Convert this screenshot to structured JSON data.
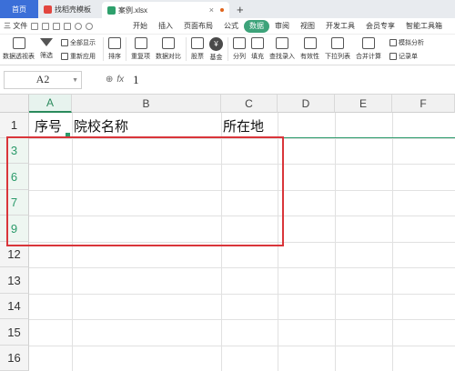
{
  "tabs": [
    {
      "label": "首页"
    },
    {
      "label": "找稻壳模板"
    },
    {
      "label": "案例.xlsx"
    }
  ],
  "tab_plus": "+",
  "menu_left": {
    "file": "三 文件"
  },
  "menus": [
    "开始",
    "插入",
    "页面布局",
    "公式",
    "数据",
    "审阅",
    "视图",
    "开发工具",
    "会员专享",
    "智能工具箱"
  ],
  "ribbon": {
    "pivot": "数据透视表",
    "filter": "筛选",
    "show_all": "全部显示",
    "reapply": "重新应用",
    "sort": "排序",
    "dup": "重复项",
    "compare": "数据对比",
    "stock": "股票",
    "fund": "基金",
    "split": "分列",
    "fill": "填充",
    "lookup": "查找录入",
    "valid": "有效性",
    "dropdown": "下拉列表",
    "merge": "合并计算",
    "sim": "模拟分析",
    "record": "记录单"
  },
  "formula": {
    "cell_ref": "A2",
    "fx": "fx",
    "value": "1"
  },
  "columns": [
    "A",
    "B",
    "C",
    "D",
    "E",
    "F"
  ],
  "rows": [
    "1",
    "3",
    "6",
    "7",
    "9",
    "12",
    "13",
    "14",
    "15",
    "16"
  ],
  "cells": {
    "a1": "序号",
    "b1": "院校名称",
    "c1": "所在地"
  },
  "colors": {
    "accent": "#2a9a6a",
    "highlight": "#d9353a",
    "home_tab": "#3b6fd8"
  }
}
